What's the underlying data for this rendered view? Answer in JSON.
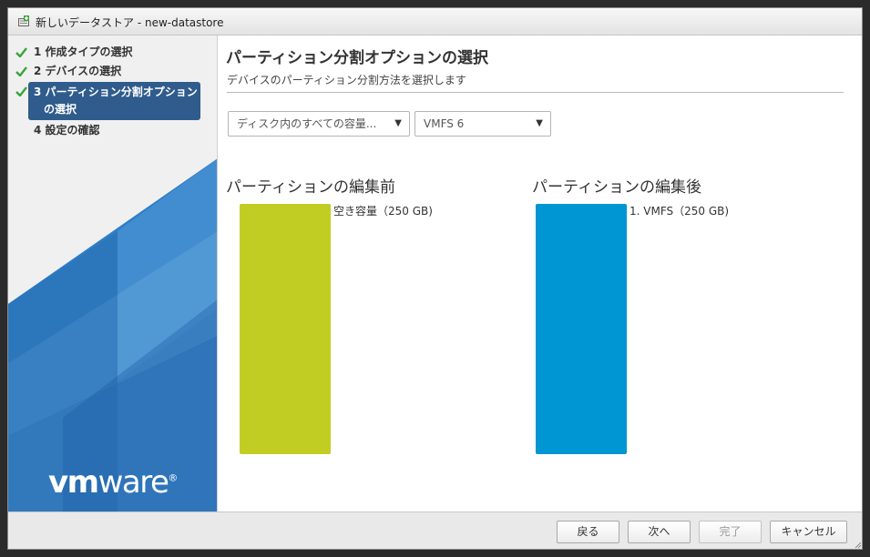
{
  "window": {
    "title": "新しいデータストア - new-datastore"
  },
  "sidebar": {
    "steps": [
      {
        "label": "1 作成タイプの選択",
        "status": "complete"
      },
      {
        "label": "2 デバイスの選択",
        "status": "complete"
      },
      {
        "label_line1": "3 パーティション分割オプション",
        "label_line2": "の選択",
        "status": "active"
      },
      {
        "label": "4 設定の確認",
        "status": "pending"
      }
    ],
    "logo": {
      "text_vm": "vm",
      "text_ware": "ware",
      "reg": "®"
    }
  },
  "main": {
    "title": "パーティション分割オプションの選択",
    "subtitle": "デバイスのパーティション分割方法を選択します",
    "partition_option_select": {
      "value": "ディスク内のすべての容量..."
    },
    "filesystem_select": {
      "value": "VMFS 6"
    },
    "before": {
      "heading": "パーティションの編集前",
      "bar_label": "空き容量（250 GB)",
      "fill_fraction": 1.0,
      "color": "#c2cd23"
    },
    "after": {
      "heading": "パーティションの編集後",
      "bar_label": "1. VMFS（250 GB)",
      "fill_fraction": 1.0,
      "color": "#0095d3"
    }
  },
  "footer": {
    "back_label": "戻る",
    "next_label": "次へ",
    "finish_label": "完了",
    "cancel_label": "キャンセル"
  },
  "colors": {
    "accent": "#2f5c8c",
    "check": "#3aa33a",
    "sidebar_blue": "#2c73b7"
  }
}
